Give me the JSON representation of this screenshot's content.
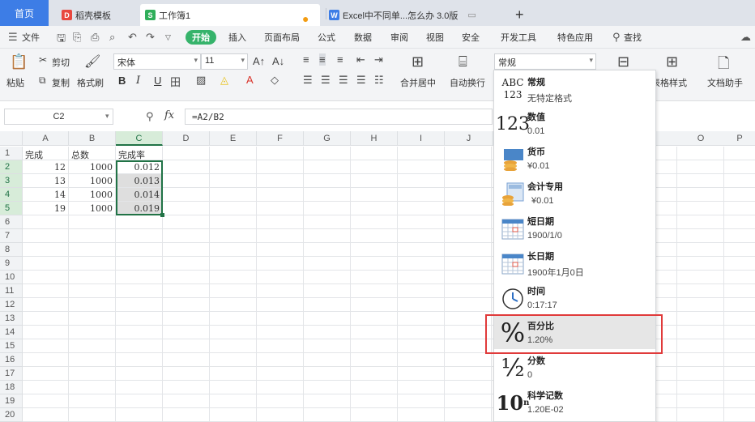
{
  "tabs": {
    "home": "首页",
    "t1": "稻壳模板",
    "t2": "工作簿1",
    "t3": "Excel中不同单...怎么办 3.0版",
    "add": "+"
  },
  "menu": {
    "file": "文件",
    "start": "开始",
    "items": [
      "插入",
      "页面布局",
      "公式",
      "数据",
      "审阅",
      "视图",
      "安全",
      "开发工具",
      "特色应用"
    ],
    "search": "查找"
  },
  "ribbon": {
    "paste": "粘贴",
    "cut": "剪切",
    "copy": "复制",
    "format_painter": "格式刷",
    "font": "宋体",
    "size": "11",
    "merge": "合并居中",
    "wrap": "自动换行",
    "format": "常规",
    "table_style": "表格样式",
    "doc_helper": "文档助手",
    "bold": "B",
    "italic": "I",
    "underline": "U"
  },
  "formula_bar": {
    "name_box": "C2",
    "fx": "fx",
    "formula": "=A2/B2"
  },
  "columns": [
    "A",
    "B",
    "C",
    "D",
    "E",
    "F",
    "G",
    "H",
    "I",
    "J",
    "O",
    "P"
  ],
  "rows": [
    "1",
    "2",
    "3",
    "4",
    "5",
    "6",
    "7",
    "8",
    "9",
    "10",
    "11",
    "12",
    "13",
    "14",
    "15",
    "16",
    "17",
    "18",
    "19",
    "20"
  ],
  "cells": {
    "A1": "完成",
    "B1": "总数",
    "C1": "完成率",
    "A2": "12",
    "B2": "1000",
    "C2": "0.012",
    "A3": "13",
    "B3": "1000",
    "C3": "0.013",
    "A4": "14",
    "B4": "1000",
    "C4": "0.014",
    "A5": "19",
    "B5": "1000",
    "C5": "0.019"
  },
  "format_options": [
    {
      "title": "常规",
      "sample": "无特定格式",
      "icon": "abc-123-icon"
    },
    {
      "title": "数值",
      "sample": "0.01",
      "icon": "number-123-icon"
    },
    {
      "title": "货币",
      "sample": "¥0.01",
      "icon": "currency-coins-icon"
    },
    {
      "title": "会计专用",
      "sample": "¥0.01",
      "icon": "accounting-calculator-icon"
    },
    {
      "title": "短日期",
      "sample": "1900/1/0",
      "icon": "calendar-short-icon"
    },
    {
      "title": "长日期",
      "sample": "1900年1月0日",
      "icon": "calendar-long-icon"
    },
    {
      "title": "时间",
      "sample": "0:17:17",
      "icon": "clock-icon"
    },
    {
      "title": "百分比",
      "sample": "1.20%",
      "icon": "percent-icon"
    },
    {
      "title": "分数",
      "sample": "0",
      "icon": "fraction-icon"
    },
    {
      "title": "科学记数",
      "sample": "1.20E-02",
      "icon": "scientific-notation-icon"
    }
  ]
}
